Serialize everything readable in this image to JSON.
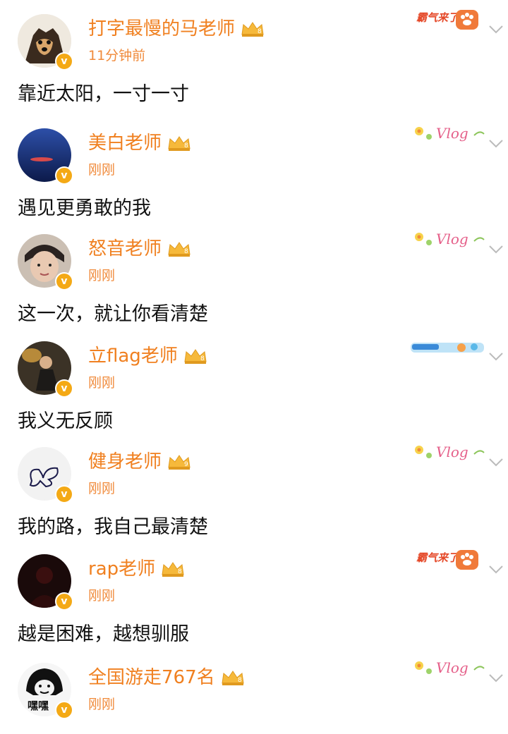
{
  "posts": [
    {
      "name": "打字最慢的马老师",
      "time": "11分钟前",
      "content": "靠近太阳，一寸一寸",
      "level": "8",
      "deco": "霸气来了",
      "deco_type": "paw"
    },
    {
      "name": "美白老师",
      "time": "刚刚",
      "content": "遇见更勇敢的我",
      "level": "8",
      "deco": "Vlog",
      "deco_type": "vlog"
    },
    {
      "name": "怒音老师",
      "time": "刚刚",
      "content": "这一次，就让你看清楚",
      "level": "8",
      "deco": "Vlog",
      "deco_type": "vlog"
    },
    {
      "name": "立flag老师",
      "time": "刚刚",
      "content": "我义无反顾",
      "level": "8",
      "deco": "",
      "deco_type": "strip"
    },
    {
      "name": "健身老师",
      "time": "刚刚",
      "content": "我的路，我自己最清楚",
      "level": "9",
      "deco": "Vlog",
      "deco_type": "vlog"
    },
    {
      "name": "rap老师",
      "time": "刚刚",
      "content": "越是困难，越想驯服",
      "level": "8",
      "deco": "霸气来了",
      "deco_type": "paw"
    },
    {
      "name": "全国游走767名",
      "time": "刚刚",
      "content": "",
      "level": "8",
      "deco": "Vlog",
      "deco_type": "vlog"
    }
  ],
  "avatar_caption_7": "嘿嘿",
  "icons": {
    "verified": "v-badge-icon",
    "crown": "crown-level-icon",
    "menu": "chevron-down-icon"
  },
  "colors": {
    "name": "#f08020",
    "time": "#f08a3a",
    "badge": "#f4a915",
    "text": "#111111"
  }
}
